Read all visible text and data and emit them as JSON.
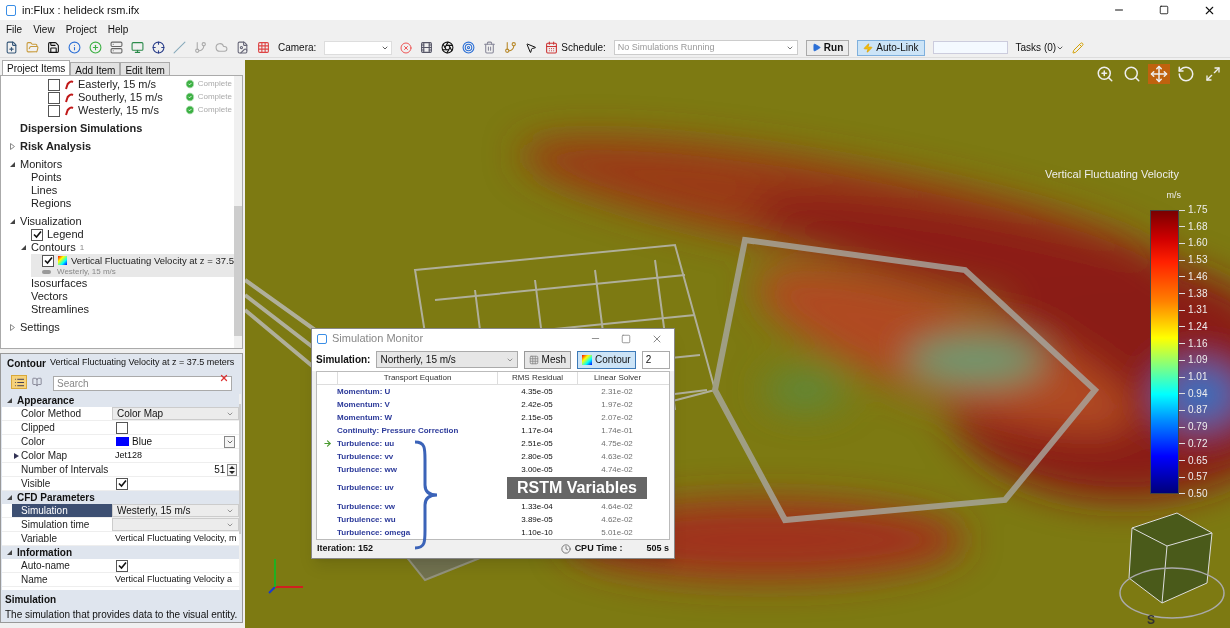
{
  "window": {
    "title": "in:Flux : helideck rsm.ifx"
  },
  "menu": [
    "File",
    "View",
    "Project",
    "Help"
  ],
  "toolbar": {
    "camera_label": "Camera:",
    "schedule_label": "Schedule:",
    "schedule_value": "No Simulations Running",
    "run": "Run",
    "auto_link": {
      "label": "Auto-Link",
      "on": true
    },
    "tasks": "Tasks (0)"
  },
  "viewport_tools": [
    {
      "kind": "zoom-box",
      "selected": false
    },
    {
      "kind": "zoom",
      "selected": false
    },
    {
      "kind": "pan",
      "selected": true
    },
    {
      "kind": "rotate",
      "selected": false
    },
    {
      "kind": "fit",
      "selected": false
    }
  ],
  "sidebar": {
    "tabs": [
      {
        "label": "Project Items",
        "selected": true
      },
      {
        "label": "Add Item",
        "selected": false
      },
      {
        "label": "Edit Item",
        "selected": false
      }
    ],
    "tree": [
      {
        "kind": "sim",
        "label": "Easterly, 15 m/s",
        "checked": false,
        "status": "Complete"
      },
      {
        "kind": "sim",
        "label": "Southerly, 15 m/s",
        "checked": false,
        "status": "Complete"
      },
      {
        "kind": "sim",
        "label": "Westerly, 15 m/s",
        "checked": false,
        "status": "Complete"
      },
      {
        "kind": "group",
        "label": "Dispersion Simulations"
      },
      {
        "kind": "group",
        "label": "Risk Analysis",
        "expanded": false
      },
      {
        "kind": "item",
        "label": "Monitors",
        "expanded": true,
        "children": [
          {
            "kind": "item",
            "label": "Points"
          },
          {
            "kind": "item",
            "label": "Lines"
          },
          {
            "kind": "item",
            "label": "Regions"
          }
        ]
      },
      {
        "kind": "item",
        "label": "Visualization",
        "expanded": true,
        "children": [
          {
            "kind": "item",
            "label": "Legend",
            "checked": true
          },
          {
            "kind": "item",
            "label": "Contours",
            "expanded": true,
            "count": "1",
            "children": [
              {
                "kind": "contour",
                "label": "Vertical Fluctuating Velocity at z = 37.5",
                "sublabel": "Westerly, 15 m/s",
                "checked": true,
                "selected": true
              }
            ]
          },
          {
            "kind": "item",
            "label": "Isosurfaces"
          },
          {
            "kind": "item",
            "label": "Vectors"
          },
          {
            "kind": "item",
            "label": "Streamlines"
          }
        ]
      },
      {
        "kind": "item",
        "label": "Settings",
        "expanded": false
      }
    ]
  },
  "properties": {
    "type": "Contour",
    "name": "Vertical Fluctuating Velocity at z = 37.5 meters",
    "search_placeholder": "Search",
    "categories": [
      {
        "name": "Appearance",
        "expanded": true,
        "rows": [
          {
            "kind": "dropdown",
            "name": "Color Method",
            "value": "Color Map",
            "selected": false
          },
          {
            "kind": "checkbox",
            "name": "Clipped",
            "checked": false,
            "selected": false
          },
          {
            "kind": "color",
            "name": "Color",
            "value": "Blue",
            "color": "#0000ff",
            "selected": false
          },
          {
            "kind": "text",
            "name": "Color Map",
            "value": "Jet128",
            "expanded": false,
            "selected": false
          },
          {
            "kind": "spin",
            "name": "Number of Intervals",
            "value": "51",
            "selected": false
          },
          {
            "kind": "checkbox",
            "name": "Visible",
            "checked": true,
            "selected": false
          }
        ]
      },
      {
        "name": "CFD Parameters",
        "expanded": true,
        "rows": [
          {
            "kind": "dropdown",
            "name": "Simulation",
            "value": "Westerly, 15 m/s",
            "selected": true
          },
          {
            "kind": "dropdown",
            "name": "Simulation time",
            "selected": false
          },
          {
            "kind": "text",
            "name": "Variable",
            "value": "Vertical Fluctuating Velocity, m",
            "selected": false
          }
        ]
      },
      {
        "name": "Information",
        "expanded": true,
        "rows": [
          {
            "kind": "checkbox",
            "name": "Auto-name",
            "checked": true,
            "selected": false
          },
          {
            "kind": "text",
            "name": "Name",
            "value": "Vertical Fluctuating Velocity a",
            "selected": false
          }
        ]
      }
    ],
    "description": {
      "title": "Simulation",
      "text": "The simulation that provides data to the visual entity."
    }
  },
  "legend": {
    "title": "Vertical Fluctuating Velocity",
    "unit": "m/s",
    "ticks": [
      "1.75",
      "1.68",
      "1.60",
      "1.53",
      "1.46",
      "1.38",
      "1.31",
      "1.24",
      "1.16",
      "1.09",
      "1.01",
      "0.94",
      "0.87",
      "0.79",
      "0.72",
      "0.65",
      "0.57",
      "0.50"
    ]
  },
  "monitor": {
    "title": "Simulation Monitor",
    "simulation_label": "Simulation:",
    "simulation": "Northerly, 15 m/s",
    "mesh": {
      "label": "Mesh",
      "selected": false
    },
    "contour": {
      "label": "Contour",
      "selected": true
    },
    "count": "2",
    "columns": [
      "Transport Equation",
      "RMS Residual",
      "Linear Solver"
    ],
    "rows": [
      {
        "equation": "Momentum: U",
        "rms": "4.35e-05",
        "linear": "2.31e-02",
        "current": false,
        "covered": false
      },
      {
        "equation": "Momentum: V",
        "rms": "2.42e-05",
        "linear": "1.97e-02",
        "current": false,
        "covered": false
      },
      {
        "equation": "Momentum: W",
        "rms": "2.15e-05",
        "linear": "2.07e-02",
        "current": false,
        "covered": false
      },
      {
        "equation": "Continuity: Pressure Correction",
        "rms": "1.17e-04",
        "linear": "1.74e-01",
        "current": false,
        "covered": false
      },
      {
        "equation": "Turbulence: uu",
        "rms": "2.51e-05",
        "linear": "4.75e-02",
        "current": true,
        "covered": false
      },
      {
        "equation": "Turbulence: vv",
        "rms": "2.80e-05",
        "linear": "4.63e-02",
        "current": false,
        "covered": false
      },
      {
        "equation": "Turbulence: ww",
        "rms": "3.00e-05",
        "linear": "4.74e-02",
        "current": false,
        "covered": false
      },
      {
        "equation": "Turbulence: uv",
        "current": false,
        "covered": true
      },
      {
        "equation": "Turbulence: vw",
        "rms": "1.33e-04",
        "linear": "4.64e-02",
        "current": false,
        "covered": false
      },
      {
        "equation": "Turbulence: wu",
        "rms": "3.89e-05",
        "linear": "4.62e-02",
        "current": false,
        "covered": false
      },
      {
        "equation": "Turbulence: omega",
        "rms": "1.10e-10",
        "linear": "5.01e-02",
        "current": false,
        "covered": false
      }
    ],
    "iteration": "Iteration: 152",
    "cpu_label": "CPU Time :",
    "cpu_value": "505 s",
    "annotation": "RSTM Variables"
  },
  "view_cube": {
    "compass_label": "S"
  }
}
